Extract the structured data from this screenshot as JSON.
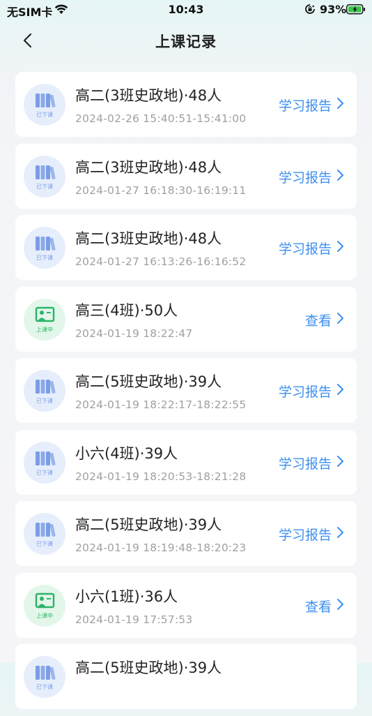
{
  "status_bar": {
    "carrier": "无SIM卡",
    "time": "10:43",
    "battery": "93%"
  },
  "nav": {
    "title": "上课记录"
  },
  "records": [
    {
      "name": "高二(3班史政地)·48人",
      "time": "2024-02-26 15:40:51-15:41:00",
      "action": "学习报告",
      "status": "ended",
      "badge": "已下课"
    },
    {
      "name": "高二(3班史政地)·48人",
      "time": "2024-01-27 16:18:30-16:19:11",
      "action": "学习报告",
      "status": "ended",
      "badge": "已下课"
    },
    {
      "name": "高二(3班史政地)·48人",
      "time": "2024-01-27 16:13:26-16:16:52",
      "action": "学习报告",
      "status": "ended",
      "badge": "已下课"
    },
    {
      "name": "高三(4班)·50人",
      "time": "2024-01-19 18:22:47",
      "action": "查看",
      "status": "live",
      "badge": "上课中"
    },
    {
      "name": "高二(5班史政地)·39人",
      "time": "2024-01-19 18:22:17-18:22:55",
      "action": "学习报告",
      "status": "ended",
      "badge": "已下课"
    },
    {
      "name": "小六(4班)·39人",
      "time": "2024-01-19 18:20:53-18:21:28",
      "action": "学习报告",
      "status": "ended",
      "badge": "已下课"
    },
    {
      "name": "高二(5班史政地)·39人",
      "time": "2024-01-19 18:19:48-18:20:23",
      "action": "学习报告",
      "status": "ended",
      "badge": "已下课"
    },
    {
      "name": "小六(1班)·36人",
      "time": "2024-01-19 17:57:53",
      "action": "查看",
      "status": "live",
      "badge": "上课中"
    },
    {
      "name": "高二(5班史政地)·39人",
      "time": "",
      "action": "",
      "status": "ended",
      "badge": "已下课"
    }
  ],
  "colors": {
    "accent": "#3b8ff0",
    "ended_badge": "#7b9de6",
    "live_badge": "#2db46a"
  },
  "icons": {
    "back": "chevron-left-icon",
    "action": "chevron-right-icon",
    "ended": "books-icon",
    "live": "teacher-board-icon"
  }
}
